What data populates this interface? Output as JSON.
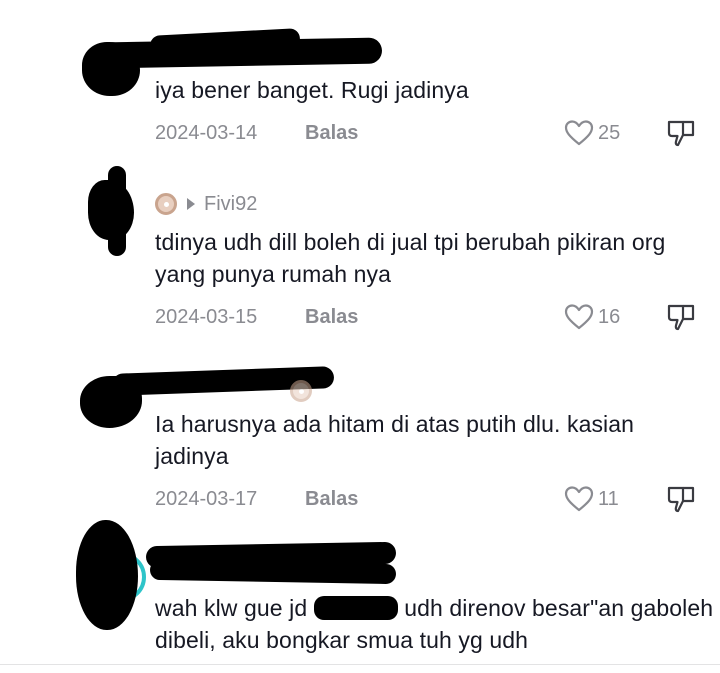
{
  "comments": [
    {
      "text": "iya bener banget. Rugi jadinya",
      "date": "2024-03-14",
      "reply_label": "Balas",
      "likes": "25"
    },
    {
      "username": "Fivi92",
      "text": "tdinya udh dill boleh di jual tpi berubah pikiran org yang punya rumah nya",
      "date": "2024-03-15",
      "reply_label": "Balas",
      "likes": "16"
    },
    {
      "text": "Ia harusnya ada hitam di atas putih dlu. kasian jadinya",
      "date": "2024-03-17",
      "reply_label": "Balas",
      "likes": "11"
    },
    {
      "text_part1": "wah klw gue jd ",
      "text_part2": " udh direnov besar\"an gaboleh dibeli, aku bongkar smua tuh yg udh"
    }
  ],
  "icons": {
    "like": "heart-icon",
    "dislike": "thumbs-down-icon",
    "badge": "donut-icon",
    "caret": "caret-right-icon"
  },
  "colors": {
    "text": "#161823",
    "muted": "#8a8b91",
    "redaction": "#000000",
    "ring": "#2ec4c9"
  }
}
